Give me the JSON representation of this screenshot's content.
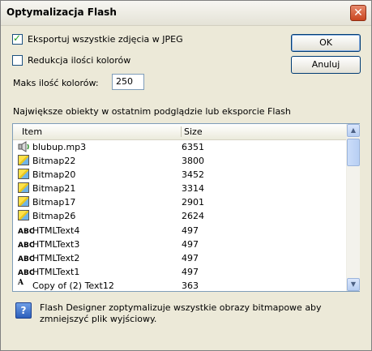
{
  "window": {
    "title": "Optymalizacja Flash"
  },
  "options": {
    "export_jpeg": {
      "label": "Eksportuj wszystkie zdjęcia w JPEG",
      "checked": true
    },
    "reduce_colors": {
      "label": "Redukcja ilości kolorów",
      "checked": false
    },
    "max_colors_label": "Maks ilość kolorów:",
    "max_colors_value": "250"
  },
  "buttons": {
    "ok": "OK",
    "cancel": "Anuluj"
  },
  "list": {
    "caption": "Największe obiekty w ostatnim podglądzie lub eksporcie Flash",
    "columns": {
      "item": "Item",
      "size": "Size"
    },
    "rows": [
      {
        "icon": "sound-icon",
        "name": "blubup.mp3",
        "size": "6351"
      },
      {
        "icon": "bitmap-icon",
        "name": "Bitmap22",
        "size": "3800"
      },
      {
        "icon": "bitmap-icon",
        "name": "Bitmap20",
        "size": "3452"
      },
      {
        "icon": "bitmap-icon",
        "name": "Bitmap21",
        "size": "3314"
      },
      {
        "icon": "bitmap-icon",
        "name": "Bitmap17",
        "size": "2901"
      },
      {
        "icon": "bitmap-icon",
        "name": "Bitmap26",
        "size": "2624"
      },
      {
        "icon": "html-text-icon",
        "name": "HTMLText4",
        "size": "497"
      },
      {
        "icon": "html-text-icon",
        "name": "HTMLText3",
        "size": "497"
      },
      {
        "icon": "html-text-icon",
        "name": "HTMLText2",
        "size": "497"
      },
      {
        "icon": "html-text-icon",
        "name": "HTMLText1",
        "size": "497"
      },
      {
        "icon": "text-icon",
        "name": "Copy of (2) Text12",
        "size": "363"
      }
    ]
  },
  "info": {
    "icon": "help-icon",
    "text": "Flash Designer zoptymalizuje wszystkie obrazy bitmapowe aby zmniejszyć plik wyjściowy."
  }
}
